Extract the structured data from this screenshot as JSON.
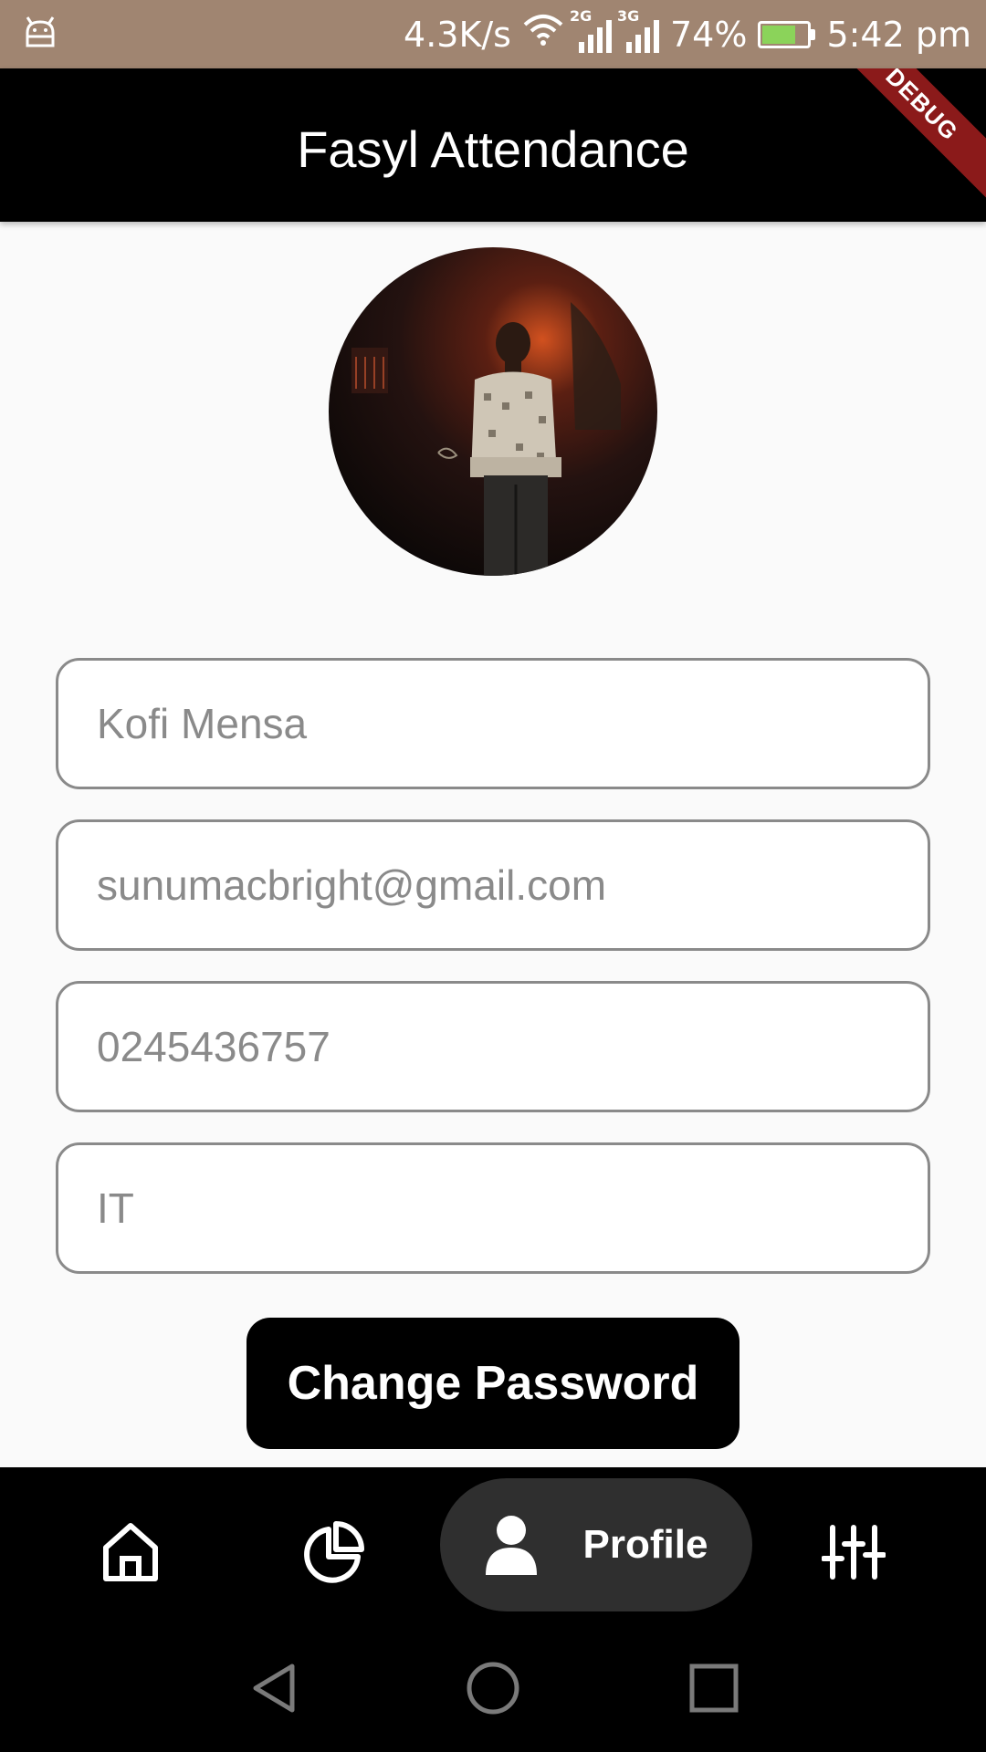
{
  "status_bar": {
    "network_speed": "4.3K/s",
    "signal_1_label": "2G",
    "signal_2_label": "3G",
    "battery_level": "74%",
    "time": "5:42 pm",
    "icons": [
      "android-icon",
      "wifi-icon",
      "signal-icon",
      "battery-charging-icon"
    ]
  },
  "app_bar": {
    "title": "Fasyl Attendance",
    "debug_banner": "DEBUG"
  },
  "profile": {
    "avatar": "profile-photo"
  },
  "form": {
    "name": "Kofi Mensa",
    "email": "sunumacbright@gmail.com",
    "phone": "0245436757",
    "department": "IT"
  },
  "actions": {
    "change_password_label": "Change Password"
  },
  "bottom_nav": {
    "items": [
      {
        "icon": "home-icon",
        "label": ""
      },
      {
        "icon": "pie-chart-icon",
        "label": ""
      },
      {
        "icon": "person-icon",
        "label": "Profile",
        "active": true
      },
      {
        "icon": "sliders-icon",
        "label": ""
      }
    ]
  },
  "system_nav": {
    "icons": [
      "back-icon",
      "home-circle-icon",
      "recents-icon"
    ]
  },
  "colors": {
    "status_bar": "#a08571",
    "app_bar": "#000000",
    "background": "#fafafa",
    "field_border": "#8a8a8a",
    "button": "#000000",
    "nav_active_pill": "#2f2f2f"
  }
}
